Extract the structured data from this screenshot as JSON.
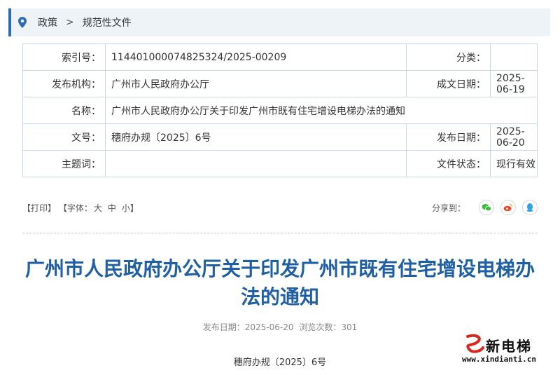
{
  "breadcrumb": {
    "items": [
      "政策",
      "规范性文件"
    ],
    "separator": ">"
  },
  "meta": {
    "index_label": "索引号：",
    "index_value": "114401000074825324/2025-00209",
    "category_label": "分类：",
    "category_value": "",
    "issuer_label": "发布机构：",
    "issuer_value": "广州市人民政府办公厅",
    "written_date_label": "成文日期：",
    "written_date_value": "2025-06-19",
    "name_label": "名称：",
    "name_value": "广州市人民政府办公厅关于印发广州市既有住宅增设电梯办法的通知",
    "doc_no_label": "文号：",
    "doc_no_value": "穗府办规〔2025〕6号",
    "publish_date_label": "发布日期：",
    "publish_date_value": "2025-06-20",
    "keywords_label": "主题词：",
    "keywords_value": "",
    "status_label": "文件状态：",
    "status_value": "现行有效"
  },
  "toolbar": {
    "print": "【打印】",
    "font_label": "【字体：",
    "font_large": "大",
    "font_medium": "中",
    "font_small": "小",
    "font_close": "】",
    "share_label": "分享到：",
    "share_icons": [
      "wechat-icon",
      "weibo-icon",
      "qq-icon"
    ]
  },
  "article": {
    "title": "广州市人民政府办公厅关于印发广州市既有住宅增设电梯办法的通知",
    "publish_info": "发布日期：2025-06-20",
    "views_info": "浏览次数：301",
    "doc_number": "穗府办规〔2025〕6号"
  },
  "watermark": {
    "brand": "新电梯",
    "url": "www.xindianti.cn"
  },
  "colors": {
    "accent": "#2d6cb0",
    "title": "#1f5fa3",
    "table_border": "#c9d7e6",
    "breadcrumb_bg": "#eef3f8",
    "wechat": "#3dbb3d",
    "weibo": "#e6492d",
    "qq": "#2aa3e0"
  }
}
